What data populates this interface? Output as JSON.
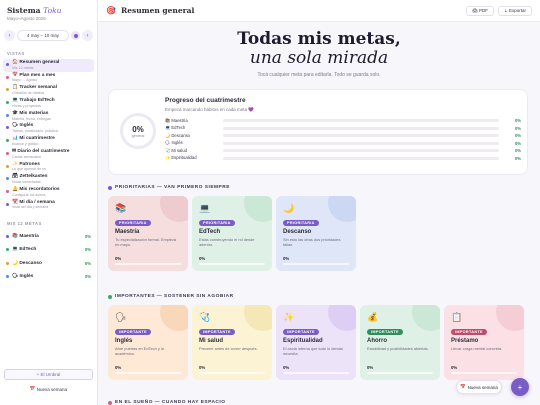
{
  "brand": {
    "title_main": "Sistema",
    "title_accent": "Toku",
    "subtitle": "Mayo–Agosto 2026"
  },
  "week": {
    "label": "4 may – 10 may",
    "prev": "‹",
    "next": "›"
  },
  "nav": {
    "section_label": "Vistas",
    "items": [
      {
        "label": "Resumen general",
        "sub": "Mis 12 metas",
        "icon": "🏠",
        "color": "#7a5cc7"
      },
      {
        "label": "Plan mes a mes",
        "sub": "Mayo → Agosto",
        "icon": "📅",
        "color": "#e05a8a"
      },
      {
        "label": "Tracker semanal",
        "sub": "Checklist de hábitos",
        "icon": "📋",
        "color": "#e59b3a"
      },
      {
        "label": "Trabajo EdTech",
        "sub": "Horas y proyectos",
        "icon": "💻",
        "color": "#3aa86b"
      },
      {
        "label": "Mis materias",
        "sub": "Materia, fecha, entregas",
        "icon": "🎓",
        "color": "#4b8ee0"
      },
      {
        "label": "Inglés",
        "sub": "Tareas, vocabulario, práctica",
        "icon": "🗣",
        "color": "#7a5cc7"
      },
      {
        "label": "Mi cuatrimestre",
        "sub": "Avance y gráfico",
        "icon": "📊",
        "color": "#3aa86b"
      },
      {
        "label": "Diario del cuatrimestre",
        "sub": "Cartas semanales",
        "icon": "✉",
        "color": "#e05a8a"
      },
      {
        "label": "Patrones",
        "sub": "Lo que aprendí de mí",
        "icon": "✨",
        "color": "#e59b3a"
      },
      {
        "label": "Zettelkasten",
        "sub": "Notas conectadas",
        "icon": "🗃",
        "color": "#4b8ee0"
      },
      {
        "label": "Mis recordatorios",
        "sub": "Configurar los avisos",
        "icon": "🔔",
        "color": "#e05a8a"
      },
      {
        "label": "Mi día / semana",
        "sub": "Vista del día y semana",
        "icon": "📆",
        "color": "#7a5cc7"
      }
    ]
  },
  "goals_section": {
    "label": "Mis 12 metas",
    "items": [
      {
        "label": "Maestría",
        "pct": "0%",
        "icon": "📚",
        "color": "#7a5cc7"
      },
      {
        "label": "EdTech",
        "pct": "0%",
        "icon": "💻",
        "color": "#3aa86b"
      },
      {
        "label": "Descanso",
        "pct": "0%",
        "icon": "🌙",
        "color": "#e59b3a"
      },
      {
        "label": "Inglés",
        "pct": "0%",
        "icon": "🗣",
        "color": "#4b8ee0"
      }
    ]
  },
  "sidebar_buttons": {
    "add": "+ El Umbral",
    "new_week": "Nueva semana"
  },
  "topbar": {
    "title": "Resumen general",
    "pdf": "PDF",
    "export": "Exportar",
    "icon": "🎯"
  },
  "hero": {
    "line1": "Todas mis metas,",
    "line2": "una sola mirada",
    "subtitle": "Tocá cualquier meta para editarla. Todo se guarda solo."
  },
  "progress": {
    "title": "Progreso del cuatrimestre",
    "subtitle": "Empezá marcando hábitos en cada meta 💜",
    "total_pct": "0%",
    "total_label": "general",
    "rows": [
      {
        "label": "📚 Maestría",
        "pct": "0%",
        "value": 0
      },
      {
        "label": "💻 EdTech",
        "pct": "0%",
        "value": 0
      },
      {
        "label": "🌙 Descanso",
        "pct": "0%",
        "value": 0
      },
      {
        "label": "🗣 Inglés",
        "pct": "0%",
        "value": 0
      },
      {
        "label": "🩺 Mi salud",
        "pct": "0%",
        "value": 0
      },
      {
        "label": "✨ Espiritualidad",
        "pct": "0%",
        "value": 0
      }
    ]
  },
  "priority_section": {
    "label": "Prioritarias — van primero siempre",
    "dot_color": "#7a5cc7"
  },
  "priority_cards": [
    {
      "icon": "📚",
      "badge": "PRIORITARIA",
      "title": "Maestría",
      "desc": "Tu especialización formal. Empieza en mayo.",
      "pct": "0%",
      "value": 0,
      "bg": "#f7dede",
      "blob": "#e8bcc2",
      "badge_color": "#7a5cc7"
    },
    {
      "icon": "💻",
      "badge": "PRIORITARIA",
      "title": "EdTech",
      "desc": "Estás construyendo el rol desde adentro.",
      "pct": "0%",
      "value": 0,
      "bg": "#dff1e6",
      "blob": "#b8e0c6",
      "badge_color": "#7a5cc7"
    },
    {
      "icon": "🌙",
      "badge": "PRIORITARIA",
      "title": "Descanso",
      "desc": "Sin esto las otras dos prioridades fallan.",
      "pct": "0%",
      "value": 0,
      "bg": "#dfe6f8",
      "blob": "#bccbf0",
      "badge_color": "#7a5cc7"
    }
  ],
  "important_section": {
    "label": "Importantes — sostener sin agobiar",
    "dot_color": "#3aa86b"
  },
  "important_cards": [
    {
      "icon": "🗣",
      "badge": "IMPORTANTE",
      "title": "Inglés",
      "desc": "Abre puertas en EdTech y lo académico.",
      "pct": "0%",
      "value": 0,
      "bg": "#fde9d6",
      "blob": "#f5cba4",
      "badge_color": "#7a5cc7"
    },
    {
      "icon": "🩺",
      "badge": "IMPORTANTE",
      "title": "Mi salud",
      "desc": "Prevenir antes de correr después.",
      "pct": "0%",
      "value": 0,
      "bg": "#fbf3d3",
      "blob": "#efdf9f",
      "badge_color": "#7a5cc7"
    },
    {
      "icon": "✨",
      "badge": "IMPORTANTE",
      "title": "Espiritualidad",
      "desc": "El ancla interna que todo lo demás necesita.",
      "pct": "0%",
      "value": 0,
      "bg": "#ece3f8",
      "blob": "#d2c0ef",
      "badge_color": "#7a5cc7"
    },
    {
      "icon": "💰",
      "badge": "IMPORTANTE",
      "title": "Ahorro",
      "desc": "Estabilidad y posibilidades abiertas.",
      "pct": "0%",
      "value": 0,
      "bg": "#dff1e6",
      "blob": "#b8e0c6",
      "badge_color": "#2f8f5a"
    },
    {
      "icon": "📋",
      "badge": "IMPORTANTE",
      "title": "Préstamo",
      "desc": "Llevar carga mental concreta.",
      "pct": "0%",
      "value": 0,
      "bg": "#fbe1e6",
      "blob": "#f0bdc8",
      "badge_color": "#c24a6c"
    }
  ],
  "dream_section": {
    "label": "En el sueño — cuando hay espacio",
    "dot_color": "#e05a8a"
  },
  "fab": {
    "new_week": "Nueva semana",
    "plus": "+"
  }
}
